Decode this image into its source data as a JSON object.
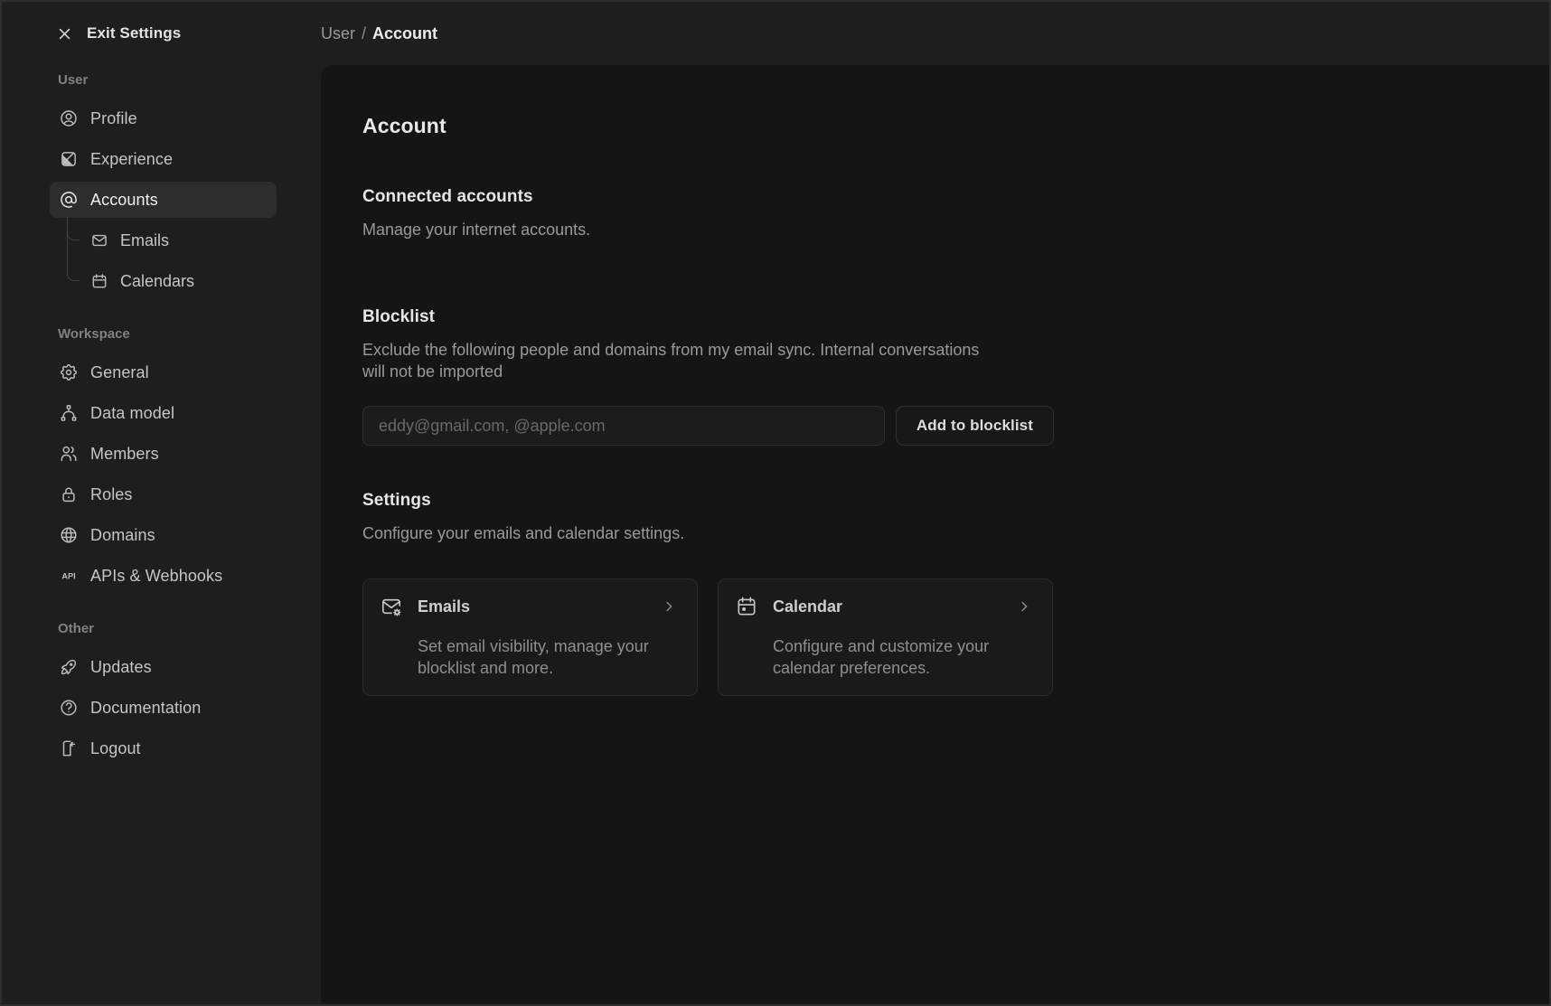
{
  "topbar": {
    "exit_label": "Exit Settings",
    "breadcrumb": {
      "section": "User",
      "separator": "/",
      "page": "Account"
    }
  },
  "sidebar": {
    "sections": [
      {
        "label": "User",
        "items": [
          {
            "label": "Profile",
            "icon": "user-circle",
            "active": false
          },
          {
            "label": "Experience",
            "icon": "appearance",
            "active": false
          },
          {
            "label": "Accounts",
            "icon": "at-sign",
            "active": true,
            "children": [
              {
                "label": "Emails",
                "icon": "mail"
              },
              {
                "label": "Calendars",
                "icon": "calendar"
              }
            ]
          }
        ]
      },
      {
        "label": "Workspace",
        "items": [
          {
            "label": "General",
            "icon": "gear",
            "active": false
          },
          {
            "label": "Data model",
            "icon": "hierarchy",
            "active": false
          },
          {
            "label": "Members",
            "icon": "users",
            "active": false
          },
          {
            "label": "Roles",
            "icon": "lock",
            "active": false
          },
          {
            "label": "Domains",
            "icon": "globe",
            "active": false
          },
          {
            "label": "APIs & Webhooks",
            "icon": "api",
            "active": false
          }
        ]
      },
      {
        "label": "Other",
        "items": [
          {
            "label": "Updates",
            "icon": "rocket",
            "active": false
          },
          {
            "label": "Documentation",
            "icon": "help-circle",
            "active": false
          },
          {
            "label": "Logout",
            "icon": "logout-door",
            "active": false
          }
        ]
      }
    ]
  },
  "main": {
    "title": "Account",
    "connected_accounts": {
      "title": "Connected accounts",
      "description": "Manage your internet accounts."
    },
    "blocklist": {
      "title": "Blocklist",
      "description": "Exclude the following people and domains from my email sync. Internal conversations will not be imported",
      "input_placeholder": "eddy@gmail.com, @apple.com",
      "input_value": "",
      "button_label": "Add to blocklist"
    },
    "settings": {
      "title": "Settings",
      "description": "Configure your emails and calendar settings.",
      "cards": [
        {
          "title": "Emails",
          "icon": "mail-cog",
          "description": "Set email visibility, manage your blocklist and more."
        },
        {
          "title": "Calendar",
          "icon": "calendar-event",
          "description": "Configure and customize your calendar preferences."
        }
      ]
    }
  },
  "colors": {
    "background_outer": "#1e1e1e",
    "background_panel": "#151515",
    "selected_item_background": "#2d2d2d",
    "card_background": "#1a1a1a",
    "border": "#2e2e2e",
    "text_primary": "#ededed",
    "text_secondary": "#9a9a9a"
  }
}
